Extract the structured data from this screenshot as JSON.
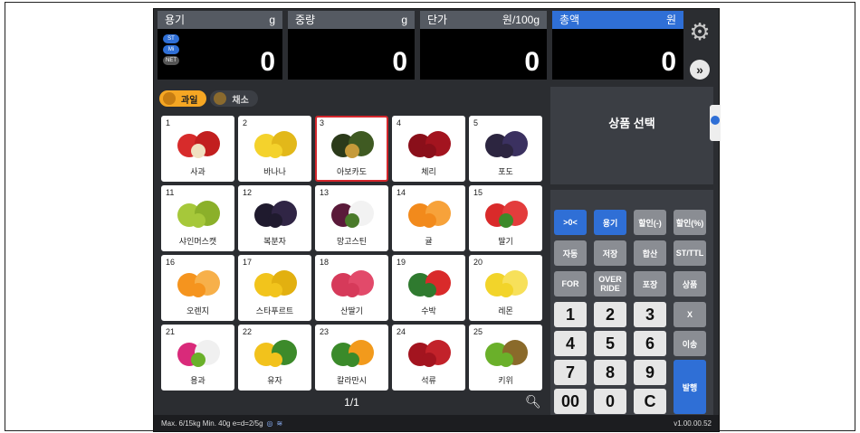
{
  "readouts": {
    "tare": {
      "label": "용기",
      "unit": "g",
      "value": "0"
    },
    "weight": {
      "label": "중량",
      "unit": "g",
      "value": "0"
    },
    "unit_price": {
      "label": "단가",
      "unit": "원/100g",
      "value": "0"
    },
    "total": {
      "label": "총액",
      "unit": "원",
      "value": "0"
    },
    "badges": [
      "ST",
      "Mi",
      "NET"
    ]
  },
  "categories": [
    {
      "label": "과일",
      "active": true
    },
    {
      "label": "채소",
      "active": false
    }
  ],
  "products": [
    {
      "num": "1",
      "name": "사과"
    },
    {
      "num": "2",
      "name": "바나나"
    },
    {
      "num": "3",
      "name": "아보카도",
      "selected": true
    },
    {
      "num": "4",
      "name": "체리"
    },
    {
      "num": "5",
      "name": "포도"
    },
    {
      "num": "11",
      "name": "샤인머스캣"
    },
    {
      "num": "12",
      "name": "복분자"
    },
    {
      "num": "13",
      "name": "망고스틴"
    },
    {
      "num": "14",
      "name": "귤"
    },
    {
      "num": "15",
      "name": "딸기"
    },
    {
      "num": "16",
      "name": "오렌지"
    },
    {
      "num": "17",
      "name": "스타푸르트"
    },
    {
      "num": "18",
      "name": "산딸기"
    },
    {
      "num": "19",
      "name": "수박"
    },
    {
      "num": "20",
      "name": "레몬"
    },
    {
      "num": "21",
      "name": "용과"
    },
    {
      "num": "22",
      "name": "유자"
    },
    {
      "num": "23",
      "name": "칼라만시"
    },
    {
      "num": "24",
      "name": "석류"
    },
    {
      "num": "25",
      "name": "키위"
    }
  ],
  "pager": {
    "text": "1/1"
  },
  "product_panel": {
    "title": "상품 선택"
  },
  "keypad": {
    "fn": [
      ">0<",
      "용기",
      "할인(-)",
      "할인(%)",
      "자동",
      "저장",
      "합산",
      "ST/TTL",
      "FOR",
      "OVER RIDE",
      "포장",
      "상품"
    ],
    "nums": [
      "1",
      "2",
      "3",
      "4",
      "5",
      "6",
      "7",
      "8",
      "9",
      "00",
      "0",
      "C"
    ],
    "side": [
      "X",
      "이송",
      "발행"
    ]
  },
  "status": {
    "capacity": "Max. 6/15kg  Min. 40g  e=d=2/5g",
    "version": "v1.00.00.52"
  },
  "colors": {
    "accent": "#2f6fd6",
    "selected_border": "#d4262c",
    "category_active": "#f5a623"
  }
}
